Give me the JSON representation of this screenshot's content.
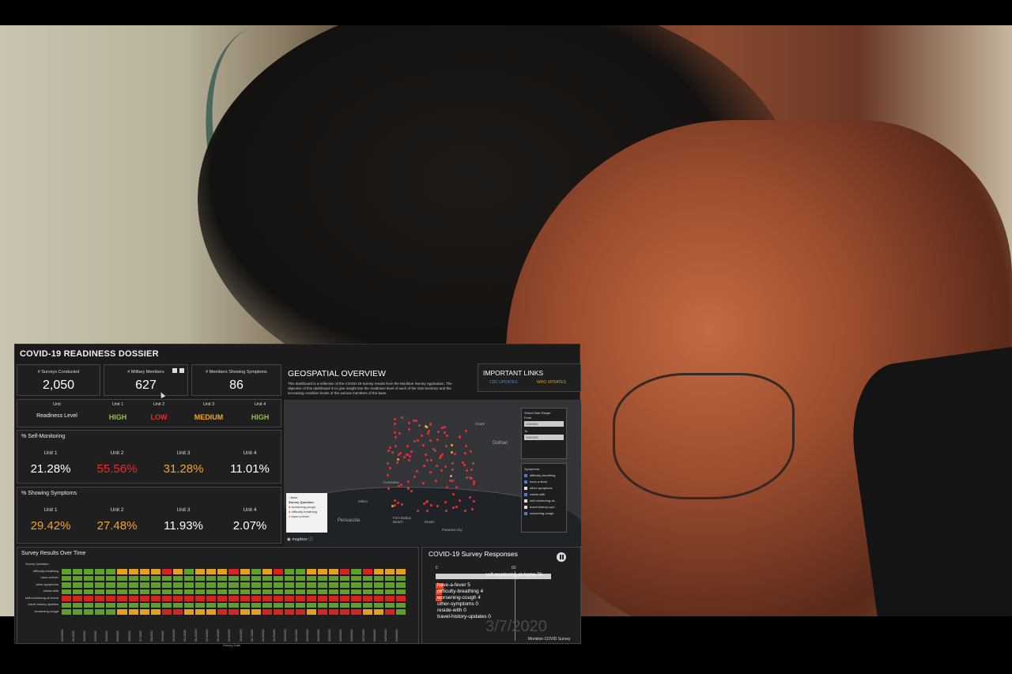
{
  "dashboard": {
    "title": "COVID-19 READINESS DOSSIER",
    "kpis": [
      {
        "label": "# Surveys Conducted",
        "value": "2,050"
      },
      {
        "label": "# Military Members",
        "value": "627"
      },
      {
        "label": "# Members Showing Symptoms",
        "value": "86"
      }
    ],
    "readiness": {
      "headers": [
        "Unit",
        "Unit 1",
        "Unit 2",
        "Unit 3",
        "Unit 4"
      ],
      "row_label": "Readiness Level",
      "levels": [
        {
          "text": "HIGH",
          "color": "#8dc63f"
        },
        {
          "text": "LOW",
          "color": "#e52d27"
        },
        {
          "text": "MEDIUM",
          "color": "#f0a623"
        },
        {
          "text": "HIGH",
          "color": "#8dc63f"
        }
      ]
    },
    "self_monitoring": {
      "title": "% Self-Monitoring",
      "units": [
        "Unit 1",
        "Unit 2",
        "Unit 3",
        "Unit 4"
      ],
      "values": [
        "21.28%",
        "55.56%",
        "31.28%",
        "11.01%"
      ],
      "colors": [
        "#ffffff",
        "#e52d27",
        "#f0a623",
        "#ffffff"
      ]
    },
    "showing_symptoms": {
      "title": "% Showing Symptoms",
      "units": [
        "Unit 1",
        "Unit 2",
        "Unit 3",
        "Unit 4"
      ],
      "values": [
        "29.42%",
        "27.48%",
        "11.93%",
        "2.07%"
      ],
      "colors": [
        "#f0a623",
        "#f0a623",
        "#ffffff",
        "#ffffff"
      ]
    },
    "geospatial": {
      "title": "GEOSPATIAL OVERVIEW",
      "description": "This dashboard is a reflection of the COVID-19 Survey results from the Monkton Survey Application. The objective of this dashboard is to give insight into the readiness level of each of the Sub-Sections and the increasing condition levels of the various members of the base."
    },
    "links": {
      "title": "IMPORTANT LINKS",
      "cdc": "CDC UPDATES",
      "who": "WHO UPDATES"
    },
    "map": {
      "places": [
        "Ozark",
        "Dothan",
        "Pensacola",
        "Milton",
        "Fort Walton Beach",
        "Destin",
        "Crestview",
        "Panama City"
      ],
      "legend_title": "Survey Question",
      "legend_base": "Base",
      "legend_items": [
        "worsening-cough",
        "difficulty-breathing",
        "have-a-fever"
      ],
      "attribution": "mapbox",
      "date_range_title": "Select Date Range",
      "from_label": "From",
      "from_value": "2/29/2020",
      "to_label": "To",
      "to_value": "3/30/2020",
      "symptoms_title": "Symptoms",
      "symptoms": [
        {
          "name": "difficulty-breathing",
          "checked": true
        },
        {
          "name": "have-a-fever",
          "checked": true
        },
        {
          "name": "other-symptoms",
          "checked": false
        },
        {
          "name": "reside-with",
          "checked": true
        },
        {
          "name": "self-monitoring-at-...",
          "checked": false
        },
        {
          "name": "travel-history-upd...",
          "checked": false
        },
        {
          "name": "worsening-cough",
          "checked": true
        }
      ]
    },
    "survey_over_time": {
      "title": "Survey Results Over Time",
      "column_header": "Survey Question",
      "questions": [
        "difficulty-breathing",
        "have-a-fever",
        "other-symptoms",
        "reside-with",
        "self-monitoring-at-home",
        "travel-history-updates",
        "worsening-cough"
      ],
      "x_title": "Survey Date",
      "dates": [
        "2/29/2020",
        "3/1/2020",
        "3/2/2020",
        "3/3/2020",
        "3/4/2020",
        "3/5/2020",
        "3/6/2020",
        "3/7/2020",
        "3/8/2020",
        "3/9/2020",
        "3/10/2020",
        "3/11/2020",
        "3/12/2020",
        "3/13/2020",
        "3/14/2020",
        "3/15/2020",
        "3/16/2020",
        "3/17/2020",
        "3/18/2020",
        "3/19/2020",
        "3/20/2020",
        "3/21/2020",
        "3/22/2020",
        "3/23/2020",
        "3/24/2020",
        "3/25/2020",
        "3/26/2020",
        "3/27/2020",
        "3/28/2020",
        "3/29/2020",
        "3/30/2020"
      ]
    },
    "responses": {
      "title": "COVID-19 Survey Responses",
      "axis": [
        "0",
        "50"
      ],
      "bars": [
        {
          "label": "self-monitoring-at-home",
          "value": 76
        },
        {
          "label": "have-a-fever",
          "value": 5
        },
        {
          "label": "difficulty-breathing",
          "value": 4
        },
        {
          "label": "worsening-cough",
          "value": 4
        },
        {
          "label": "other-symptoms",
          "value": 0
        },
        {
          "label": "reside-with",
          "value": 0
        },
        {
          "label": "travel-history-updates",
          "value": 0
        }
      ],
      "current_date": "3/7/2020",
      "source": "Monkton COVID Survey"
    }
  },
  "chart_data": [
    {
      "type": "bar",
      "title": "COVID-19 Survey Responses",
      "categories": [
        "self-monitoring-at-home",
        "have-a-fever",
        "difficulty-breathing",
        "worsening-cough",
        "other-symptoms",
        "reside-with",
        "travel-history-updates"
      ],
      "values": [
        76,
        5,
        4,
        4,
        0,
        0,
        0
      ],
      "orientation": "horizontal"
    }
  ]
}
